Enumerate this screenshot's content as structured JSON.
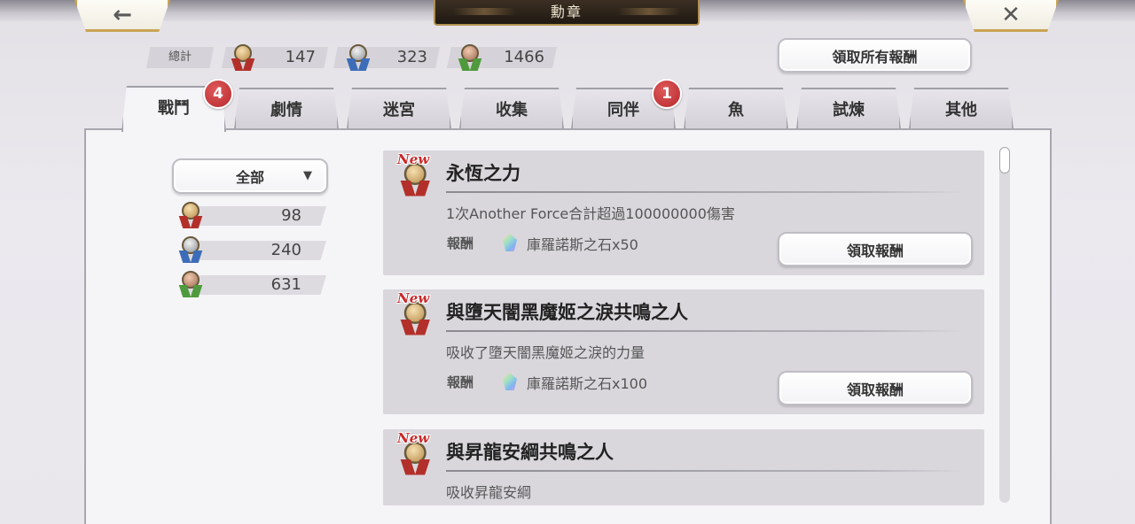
{
  "header": {
    "title": "勳章",
    "back_icon": "←",
    "close_icon": "✕"
  },
  "totals": {
    "label": "總計",
    "gold": "147",
    "silver": "323",
    "bronze": "1466"
  },
  "claim_all_label": "領取所有報酬",
  "tabs": [
    {
      "label": "戰鬥",
      "badge": "4",
      "active": true
    },
    {
      "label": "劇情"
    },
    {
      "label": "迷宮"
    },
    {
      "label": "收集"
    },
    {
      "label": "同伴",
      "badge": "1"
    },
    {
      "label": "魚"
    },
    {
      "label": "試煉"
    },
    {
      "label": "其他"
    }
  ],
  "filter": {
    "selected": "全部",
    "arrow": "▼",
    "counts": {
      "gold": "98",
      "silver": "240",
      "bronze": "631"
    }
  },
  "achievements": [
    {
      "new_tag": "New",
      "title": "永恆之力",
      "description": "1次Another Force合計超過100000000傷害",
      "reward_label": "報酬",
      "reward": "庫羅諾斯之石x50",
      "claim_label": "領取報酬"
    },
    {
      "new_tag": "New",
      "title": "與墮天闇黑魔姬之淚共鳴之人",
      "description": "吸收了墮天闇黑魔姬之淚的力量",
      "reward_label": "報酬",
      "reward": "庫羅諾斯之石x100",
      "claim_label": "領取報酬"
    },
    {
      "new_tag": "New",
      "title": "與昇龍安綱共鳴之人",
      "description": "吸收昇龍安綱"
    }
  ],
  "colors": {
    "badge": "#c0303a",
    "gold_ribbon": "#b3302a",
    "silver_ribbon": "#3d6db8",
    "bronze_ribbon": "#4f9a3c",
    "title_plate": "#2a2119",
    "nav_border": "#c9a453"
  }
}
